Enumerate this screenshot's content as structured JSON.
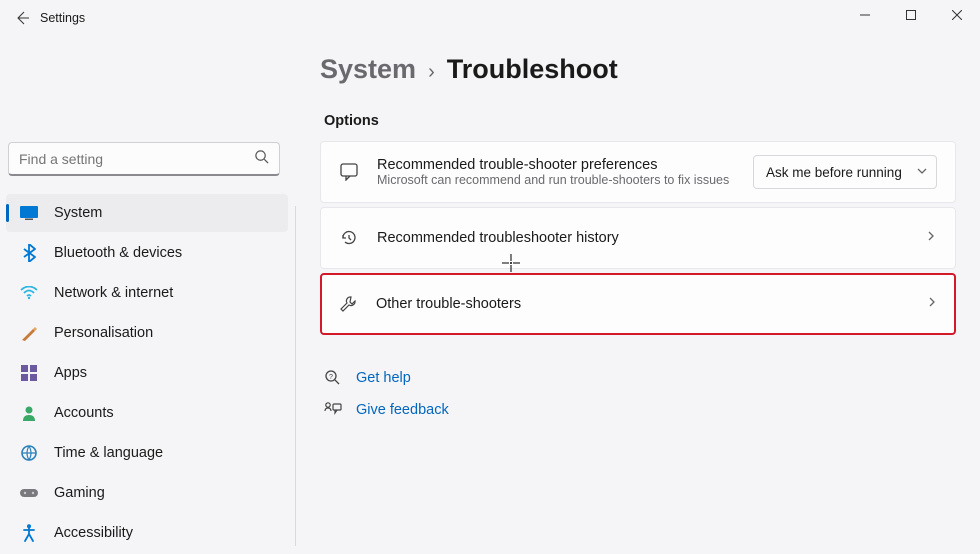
{
  "window": {
    "title": "Settings"
  },
  "search": {
    "placeholder": "Find a setting"
  },
  "sidebar": {
    "items": [
      {
        "label": "System"
      },
      {
        "label": "Bluetooth & devices"
      },
      {
        "label": "Network & internet"
      },
      {
        "label": "Personalisation"
      },
      {
        "label": "Apps"
      },
      {
        "label": "Accounts"
      },
      {
        "label": "Time & language"
      },
      {
        "label": "Gaming"
      },
      {
        "label": "Accessibility"
      }
    ]
  },
  "breadcrumb": {
    "parent": "System",
    "separator": "›",
    "current": "Troubleshoot"
  },
  "options_label": "Options",
  "cards": {
    "pref": {
      "title": "Recommended trouble-shooter preferences",
      "subtitle": "Microsoft can recommend and run trouble-shooters to fix issues",
      "dropdown_value": "Ask me before running"
    },
    "history": {
      "title": "Recommended troubleshooter history"
    },
    "other": {
      "title": "Other trouble-shooters"
    }
  },
  "links": {
    "help": "Get help",
    "feedback": "Give feedback"
  }
}
